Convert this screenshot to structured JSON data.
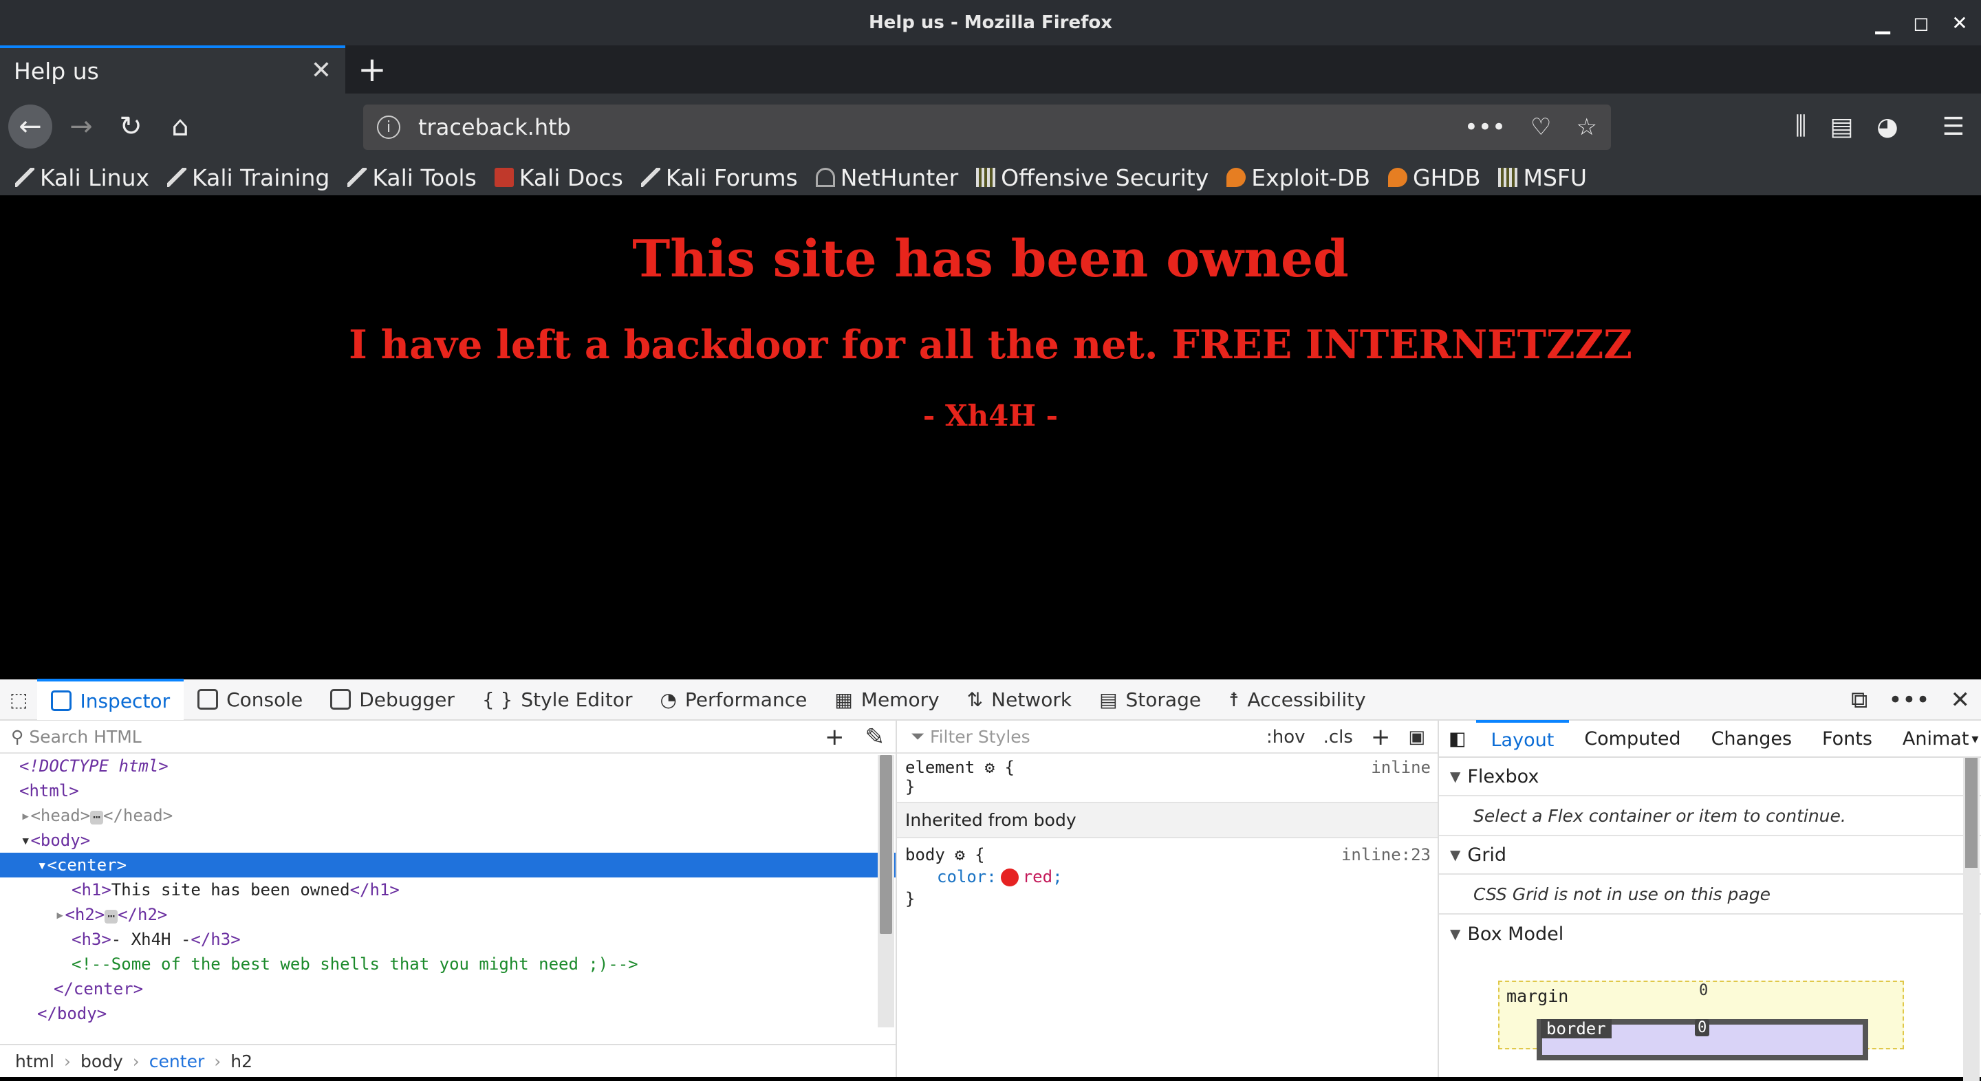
{
  "window": {
    "title": "Help us - Mozilla Firefox"
  },
  "tab": {
    "label": "Help us"
  },
  "url": {
    "value": "traceback.htb"
  },
  "bookmarks": [
    "Kali Linux",
    "Kali Training",
    "Kali Tools",
    "Kali Docs",
    "Kali Forums",
    "NetHunter",
    "Offensive Security",
    "Exploit-DB",
    "GHDB",
    "MSFU"
  ],
  "page": {
    "h1": "This site has been owned",
    "h2": "I have left a backdoor for all the net. FREE INTERNETZZZ",
    "h3": "- Xh4H -",
    "text_color": "#e8251c"
  },
  "devtools": {
    "tabs": [
      "Inspector",
      "Console",
      "Debugger",
      "Style Editor",
      "Performance",
      "Memory",
      "Network",
      "Storage",
      "Accessibility"
    ],
    "search_placeholder": "Search HTML",
    "tree": {
      "doctype": "<!DOCTYPE html>",
      "html": "<html>",
      "head": "<head>",
      "head_close": "</head>",
      "body": "<body>",
      "center": "<center>",
      "h1_open": "<h1>",
      "h1_text": "This site has been owned",
      "h1_close": "</h1>",
      "h2_open": "<h2>",
      "h2_close": "</h2>",
      "h3_open": "<h3>",
      "h3_text": "- Xh4H -",
      "h3_close": "</h3>",
      "comment": "<!--Some of the best web shells that you might need ;)-->",
      "center_close": "</center>",
      "body_close": "</body>"
    },
    "breadcrumb": [
      "html",
      "body",
      "center",
      "h2"
    ],
    "rules": {
      "filter_placeholder": "Filter Styles",
      "hov": ":hov",
      "cls": ".cls",
      "element_selector": "element",
      "element_src": "inline",
      "inherited_label": "Inherited from body",
      "body_selector": "body",
      "body_src": "inline:23",
      "prop_name": "color",
      "prop_value": "red"
    },
    "layout": {
      "subtabs": [
        "Layout",
        "Computed",
        "Changes",
        "Fonts",
        "Animat"
      ],
      "flexbox_title": "Flexbox",
      "flexbox_msg": "Select a Flex container or item to continue.",
      "grid_title": "Grid",
      "grid_msg": "CSS Grid is not in use on this page",
      "boxmodel_title": "Box Model",
      "margin_label": "margin",
      "border_label": "border",
      "zero": "0"
    }
  }
}
